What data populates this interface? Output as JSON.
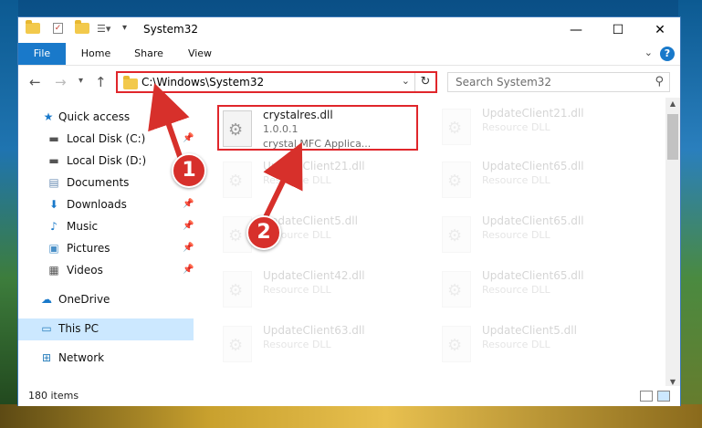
{
  "window": {
    "title": "System32",
    "controls": {
      "minimize": "—",
      "maximize": "☐",
      "close": "✕"
    }
  },
  "ribbon": {
    "tabs": [
      "File",
      "Home",
      "Share",
      "View"
    ],
    "help": "?"
  },
  "address": {
    "path": "C:\\Windows\\System32",
    "search_placeholder": "Search System32"
  },
  "nav_pane": {
    "items": [
      {
        "label": "Quick access",
        "icon": "star-icon",
        "pinned": false
      },
      {
        "label": "Local Disk (C:)",
        "icon": "drive-icon",
        "pinned": true
      },
      {
        "label": "Local Disk (D:)",
        "icon": "drive-icon",
        "pinned": false
      },
      {
        "label": "Documents",
        "icon": "documents-icon",
        "pinned": true
      },
      {
        "label": "Downloads",
        "icon": "downloads-icon",
        "pinned": true
      },
      {
        "label": "Music",
        "icon": "music-icon",
        "pinned": true
      },
      {
        "label": "Pictures",
        "icon": "pictures-icon",
        "pinned": true
      },
      {
        "label": "Videos",
        "icon": "videos-icon",
        "pinned": true
      },
      {
        "label": "OneDrive",
        "icon": "cloud-icon",
        "pinned": false
      },
      {
        "label": "This PC",
        "icon": "computer-icon",
        "pinned": false,
        "selected": true
      },
      {
        "label": "Network",
        "icon": "network-icon",
        "pinned": false
      }
    ]
  },
  "files": {
    "highlighted": {
      "name": "crystalres.dll",
      "version": "1.0.0.1",
      "description": "crystal MFC Applica..."
    },
    "faded_left": [
      {
        "name": "UpdateClient21.dll",
        "type": "Resource DLL"
      },
      {
        "name": "UpdateClient5.dll",
        "type": "Resource DLL"
      },
      {
        "name": "UpdateClient42.dll",
        "type": "Resource DLL"
      },
      {
        "name": "UpdateClient63.dll",
        "type": "Resource DLL"
      }
    ],
    "faded_right": [
      {
        "name": "UpdateClient21.dll",
        "type": "Resource DLL"
      },
      {
        "name": "UpdateClient65.dll",
        "type": "Resource DLL"
      },
      {
        "name": "UpdateClient65.dll",
        "type": "Resource DLL"
      },
      {
        "name": "UpdateClient65.dll",
        "type": "Resource DLL"
      },
      {
        "name": "UpdateClient5.dll",
        "type": "Resource DLL"
      }
    ]
  },
  "status": {
    "items_count": "180 items"
  },
  "annotations": {
    "step1": "1",
    "step2": "2"
  },
  "colors": {
    "accent": "#1979ca",
    "highlight": "#e0262b",
    "selection": "#cce8ff"
  }
}
